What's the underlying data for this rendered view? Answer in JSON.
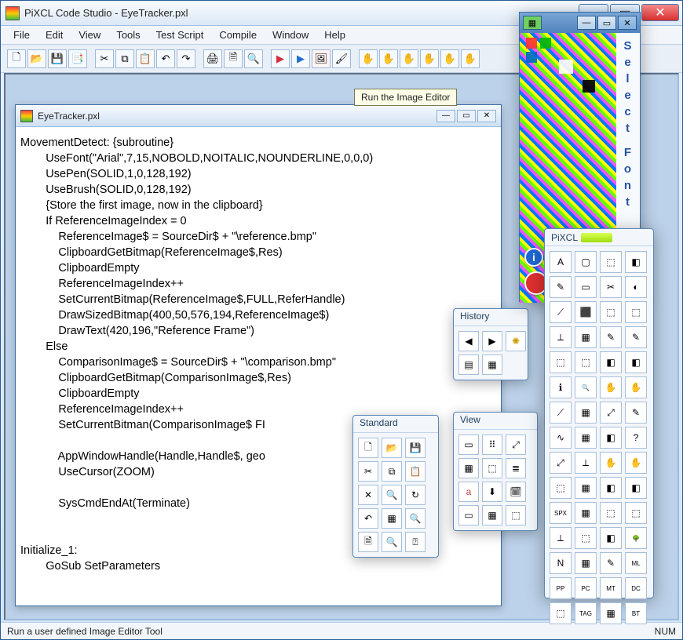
{
  "main": {
    "title": "PiXCL Code Studio - EyeTracker.pxl",
    "child_title": "EyeTracker.pxl",
    "tooltip": "Run the Image Editor",
    "status": "Run a user defined Image Editor Tool",
    "numlock": "NUM"
  },
  "menu": [
    "File",
    "Edit",
    "View",
    "Tools",
    "Test Script",
    "Compile",
    "Window",
    "Help"
  ],
  "code_lines": [
    "MovementDetect: {subroutine}",
    "        UseFont(\"Arial\",7,15,NOBOLD,NOITALIC,NOUNDERLINE,0,0,0)",
    "        UsePen(SOLID,1,0,128,192)",
    "        UseBrush(SOLID,0,128,192)",
    "        {Store the first image, now in the clipboard}",
    "        If ReferenceImageIndex = 0",
    "            ReferenceImage$ = SourceDir$ + \"\\reference.bmp\"",
    "            ClipboardGetBitmap(ReferenceImage$,Res)",
    "            ClipboardEmpty",
    "            ReferenceImageIndex++",
    "            SetCurrentBitmap(ReferenceImage$,FULL,ReferHandle)",
    "            DrawSizedBitmap(400,50,576,194,ReferenceImage$)",
    "            DrawText(420,196,\"Reference Frame\")",
    "        Else",
    "            ComparisonImage$ = SourceDir$ + \"\\comparison.bmp\"",
    "            ClipboardGetBitmap(ComparisonImage$,Res)",
    "            ClipboardEmpty",
    "            ReferenceImageIndex++",
    "            SetCurrentBitman(ComparisonImage$ FI",
    "",
    "            AppWindowHandle(Handle,Handle$, geo",
    "            UseCursor(ZOOM)",
    "",
    "            SysCmdEndAt(Terminate)",
    "",
    "",
    "Initialize_1:",
    "        GoSub SetParameters"
  ],
  "palettes": {
    "history": {
      "title": "History"
    },
    "standard": {
      "title": "Standard"
    },
    "view": {
      "title": "View"
    },
    "pixcl": {
      "title": "PiXCL"
    },
    "imgeditor_side": "Select Font"
  },
  "pixcl_tool_labels": [
    "A",
    "▢",
    "⬚",
    "◧",
    "✎",
    "▭",
    "✂",
    "◐",
    "⟋",
    "⬛",
    "⬚",
    "⬚",
    "⟂",
    "▦",
    "✎",
    "✎",
    "⬚",
    "⬚",
    "◧",
    "◧",
    "ℹ",
    "🔍",
    "✋",
    "✋",
    "⟋",
    "▦",
    "⤢",
    "✎",
    "∿",
    "▦",
    "◧",
    "?",
    "⤢",
    "⟂",
    "✋",
    "✋",
    "⬚",
    "▦",
    "◧",
    "◧",
    "SPX",
    "▦",
    "⬚",
    "⬚",
    "⟂",
    "⬚",
    "◧",
    "🌳",
    "N",
    "▦",
    "✎",
    "ML",
    "PP",
    "PC",
    "MT",
    "DC",
    "⬚",
    "TAG",
    "▦",
    "BT"
  ]
}
